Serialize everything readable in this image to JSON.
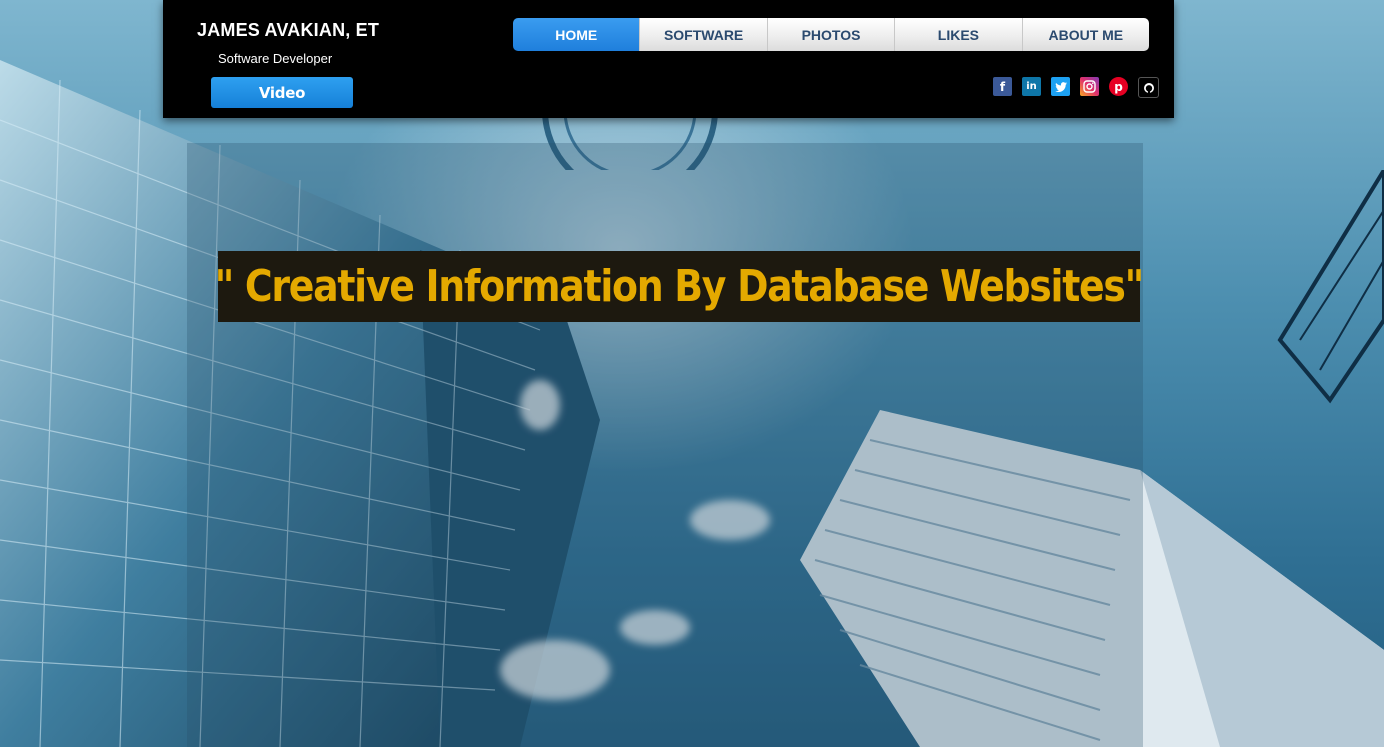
{
  "header": {
    "site_title": "JAMES AVAKIAN, ET",
    "site_subtitle": "Software Developer",
    "video_button_label": "Video"
  },
  "nav": {
    "items": [
      {
        "label": "HOME",
        "active": true
      },
      {
        "label": "SOFTWARE",
        "active": false
      },
      {
        "label": "PHOTOS",
        "active": false
      },
      {
        "label": "LIKES",
        "active": false
      },
      {
        "label": "ABOUT ME",
        "active": false
      }
    ]
  },
  "social": {
    "icons": [
      "facebook-icon",
      "linkedin-icon",
      "twitter-icon",
      "instagram-icon",
      "pinterest-icon",
      "github-icon"
    ]
  },
  "hero": {
    "headline": "\" Creative Information By Database Websites\""
  },
  "colors": {
    "nav_active": "#1f7fdc",
    "nav_text": "#2b4a6f",
    "headline_text": "#e4a900",
    "headline_bg": "#1d190f",
    "header_bg": "#000000"
  }
}
